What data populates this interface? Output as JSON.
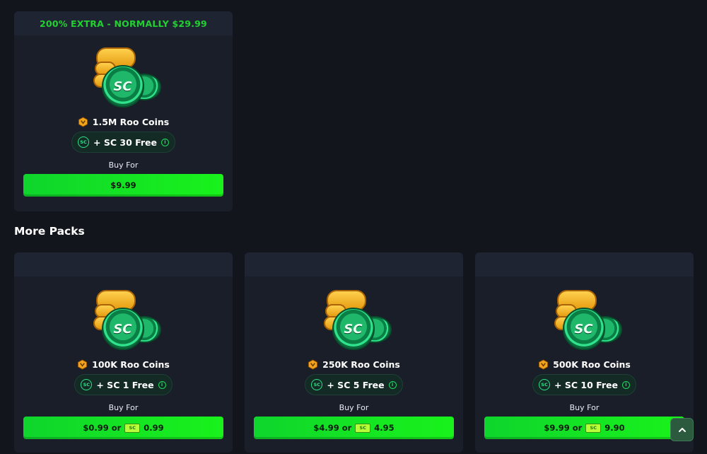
{
  "featured": {
    "banner": "200% EXTRA - NORMALLY $29.99",
    "coins_label": "1.5M Roo Coins",
    "free_label": "+ SC 30 Free",
    "buy_for": "Buy For",
    "price": "$9.99"
  },
  "section_title": "More Packs",
  "packs": [
    {
      "coins_label": "100K Roo Coins",
      "free_label": "+ SC 1 Free",
      "buy_for": "Buy For",
      "price": "$0.99 or",
      "sc_price": "0.99"
    },
    {
      "coins_label": "250K Roo Coins",
      "free_label": "+ SC 5 Free",
      "buy_for": "Buy For",
      "price": "$4.99 or",
      "sc_price": "4.95"
    },
    {
      "coins_label": "500K Roo Coins",
      "free_label": "+ SC 10 Free",
      "buy_for": "Buy For",
      "price": "$9.99 or",
      "sc_price": "9.90"
    }
  ],
  "icons": {
    "coin_glyph": "SC",
    "bill_glyph": "SC",
    "info_glyph": "i",
    "scroll_top": "chevron-up-icon"
  },
  "colors": {
    "accent_green": "#19f21b",
    "banner_text": "#21d12f",
    "card_bg": "#1a1e29",
    "page_bg": "#12151c"
  }
}
